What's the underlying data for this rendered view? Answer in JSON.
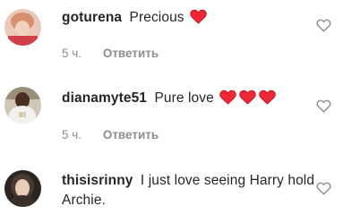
{
  "comments": [
    {
      "username": "goturena",
      "text": "Precious",
      "hearts": 1,
      "time": "5 ч.",
      "reply_label": "Ответить"
    },
    {
      "username": "dianamyte51",
      "text": "Pure love",
      "hearts": 3,
      "time": "5 ч.",
      "reply_label": "Ответить"
    },
    {
      "username": "thisisrinny",
      "text": "I just love seeing Harry hold Archie.",
      "hearts": 0
    }
  ],
  "colors": {
    "heart_red": "#ed4956",
    "text": "#262626",
    "muted": "#8e8e8e"
  },
  "icons": {
    "like": "heart-outline-icon",
    "emoji": "red-heart-emoji"
  }
}
